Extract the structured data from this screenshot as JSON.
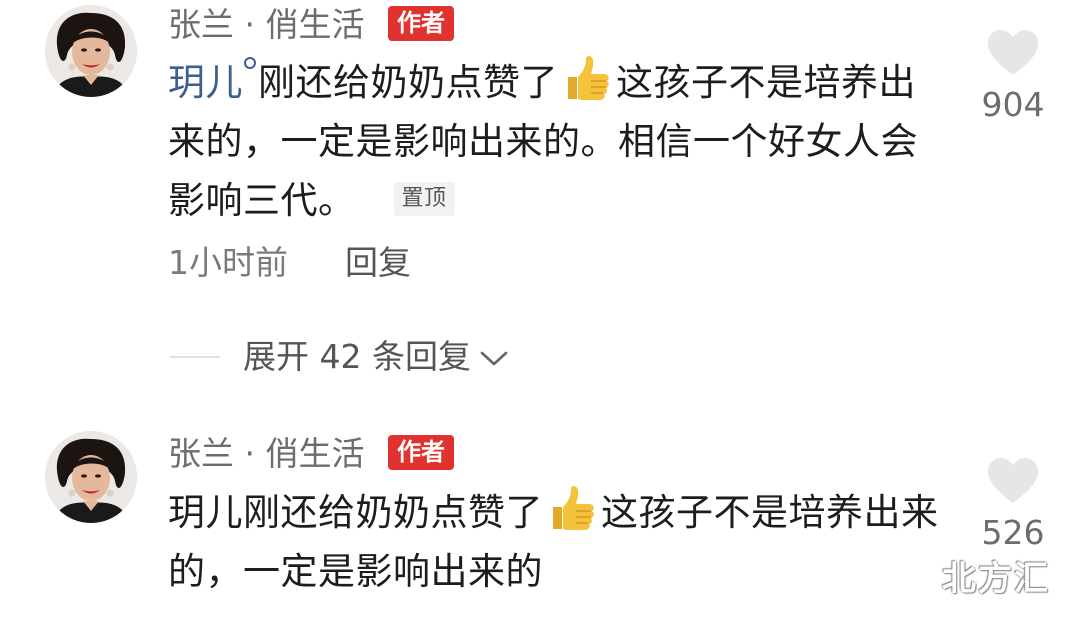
{
  "comments": [
    {
      "author": "张兰 · 俏生活",
      "author_badge": "作者",
      "mention": "玥儿",
      "text_after_mention": "刚还给奶奶点赞了",
      "thumb_emoji": "👍",
      "text_after_emoji": "这孩子不是培养出来的，一定是影响出来的。相信一个好女人会影响三代。",
      "pin_label": "置顶",
      "time": "1小时前",
      "reply_label": "回复",
      "like_count": "904",
      "expand_label": "展开 42 条回复"
    },
    {
      "author": "张兰 · 俏生活",
      "author_badge": "作者",
      "text_before_emoji": "玥儿刚还给奶奶点赞了",
      "thumb_emoji": "👍",
      "text_after_emoji": "这孩子不是培养出来的，一定是影响出来的",
      "like_count": "526"
    }
  ],
  "watermark": "北方汇",
  "colors": {
    "author_badge_bg": "#e0322f",
    "mention": "#3d5f8f",
    "body_text": "#1d1d1d",
    "meta_text": "#7a7a7a",
    "like_icon": "#e6e6e6"
  },
  "icons": [
    "avatar",
    "mention-icon",
    "thumbs-up-emoji",
    "heart-icon",
    "chevron-down-icon"
  ]
}
